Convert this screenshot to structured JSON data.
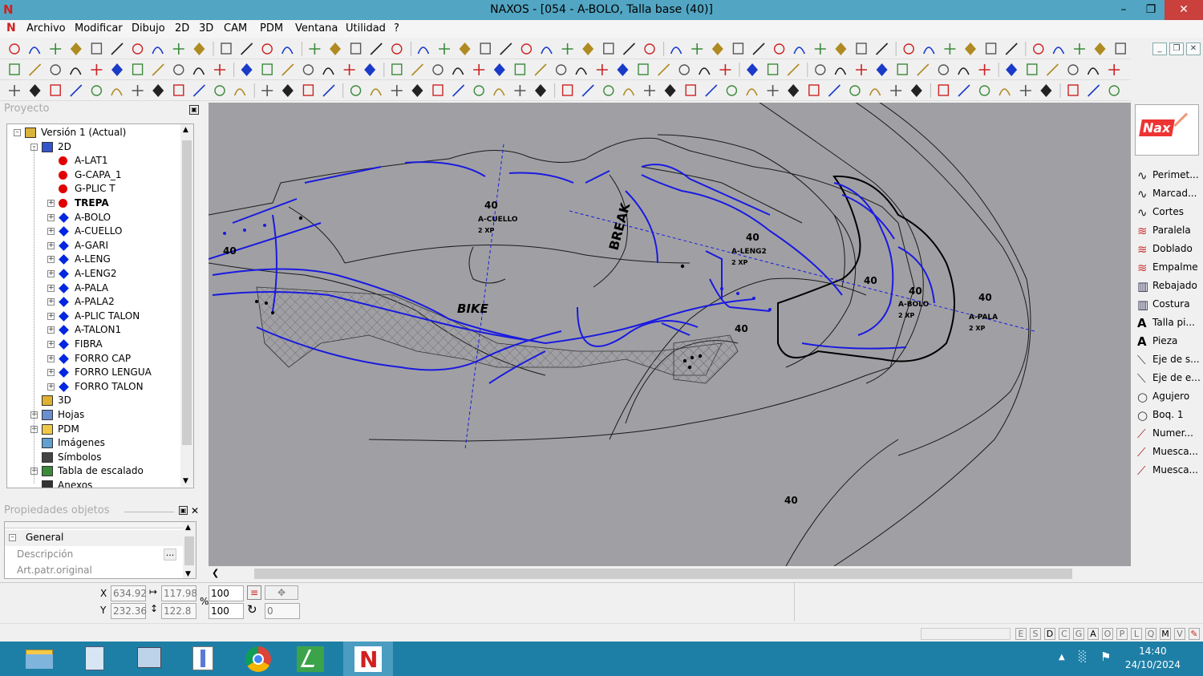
{
  "window": {
    "title": "NAXOS - [054 - A-BOLO, Talla base (40)]",
    "app_icon": "N"
  },
  "menu": [
    "Archivo",
    "Modificar",
    "Dibujo",
    "2D",
    "3D",
    "CAM",
    "PDM",
    "Ventana",
    "Utilidad",
    "?"
  ],
  "project_panel": {
    "title": "Proyecto"
  },
  "tree": [
    {
      "label": "Versión 1 (Actual)",
      "level": 0,
      "icon": "version-icon",
      "expander": "-"
    },
    {
      "label": "2D",
      "level": 1,
      "icon": "2d-icon",
      "expander": "-"
    },
    {
      "label": "A-LAT1",
      "level": 2,
      "icon": "red-dot"
    },
    {
      "label": "G-CAPA_1",
      "level": 2,
      "icon": "red-dot"
    },
    {
      "label": "G-PLIC T",
      "level": 2,
      "icon": "red-dot"
    },
    {
      "label": "TREPA",
      "level": 2,
      "icon": "red-dot",
      "expander": "+",
      "bold": true
    },
    {
      "label": "A-BOLO",
      "level": 2,
      "icon": "blue-diamond",
      "expander": "+"
    },
    {
      "label": "A-CUELLO",
      "level": 2,
      "icon": "blue-diamond",
      "expander": "+"
    },
    {
      "label": "A-GARI",
      "level": 2,
      "icon": "blue-diamond",
      "expander": "+"
    },
    {
      "label": "A-LENG",
      "level": 2,
      "icon": "blue-diamond",
      "expander": "+"
    },
    {
      "label": "A-LENG2",
      "level": 2,
      "icon": "blue-diamond",
      "expander": "+"
    },
    {
      "label": "A-PALA",
      "level": 2,
      "icon": "blue-diamond",
      "expander": "+"
    },
    {
      "label": "A-PALA2",
      "level": 2,
      "icon": "blue-diamond",
      "expander": "+"
    },
    {
      "label": "A-PLIC TALON",
      "level": 2,
      "icon": "blue-diamond",
      "expander": "+"
    },
    {
      "label": "A-TALON1",
      "level": 2,
      "icon": "blue-diamond",
      "expander": "+"
    },
    {
      "label": "FIBRA",
      "level": 2,
      "icon": "blue-diamond",
      "expander": "+"
    },
    {
      "label": "FORRO CAP",
      "level": 2,
      "icon": "blue-diamond",
      "expander": "+"
    },
    {
      "label": "FORRO LENGUA",
      "level": 2,
      "icon": "blue-diamond",
      "expander": "+"
    },
    {
      "label": "FORRO TALON",
      "level": 2,
      "icon": "blue-diamond",
      "expander": "+"
    },
    {
      "label": "3D",
      "level": 1,
      "icon": "3d-icon"
    },
    {
      "label": "Hojas",
      "level": 1,
      "icon": "sheets-icon",
      "expander": "+"
    },
    {
      "label": "PDM",
      "level": 1,
      "icon": "folder-icon",
      "expander": "+"
    },
    {
      "label": "Imágenes",
      "level": 1,
      "icon": "images-icon"
    },
    {
      "label": "Símbolos",
      "level": 1,
      "icon": "symbols-icon"
    },
    {
      "label": "Tabla de escalado",
      "level": 1,
      "icon": "table-icon",
      "expander": "+"
    },
    {
      "label": "Anexos",
      "level": 1,
      "icon": "attachment-icon"
    }
  ],
  "properties_panel": {
    "title": "Propiedades objetos",
    "group": "General",
    "rows": [
      {
        "label": "Descripción",
        "value": "",
        "button": "..."
      },
      {
        "label": "Art.patr.original",
        "value": ""
      }
    ]
  },
  "canvas": {
    "labels": [
      "40",
      "A-CUELLO",
      "2 XP",
      "40",
      "40",
      "A-LENG2",
      "2 XP",
      "40",
      "40",
      "A-BOLO",
      "2 XP",
      "40",
      "A-PALA",
      "2 XP",
      "40",
      "40",
      "40",
      "BREAK",
      "BIKE"
    ]
  },
  "right_tools": [
    {
      "label": "Perimet...",
      "icon": "curve-icon"
    },
    {
      "label": "Marcad...",
      "icon": "curve-icon"
    },
    {
      "label": "Cortes",
      "icon": "curve-icon"
    },
    {
      "label": "Paralela",
      "icon": "parallel-icon"
    },
    {
      "label": "Doblado",
      "icon": "parallel-icon"
    },
    {
      "label": "Empalme",
      "icon": "parallel-icon"
    },
    {
      "label": "Rebajado",
      "icon": "skive-icon"
    },
    {
      "label": "Costura",
      "icon": "skive-icon"
    },
    {
      "label": "Talla pi...",
      "icon": "text-a-icon"
    },
    {
      "label": "Pieza",
      "icon": "text-a-icon"
    },
    {
      "label": "Eje de s...",
      "icon": "axis-icon"
    },
    {
      "label": "Eje de e...",
      "icon": "axis-icon"
    },
    {
      "label": "Agujero",
      "icon": "circle-icon"
    },
    {
      "label": "Boq. 1",
      "icon": "circle-icon"
    },
    {
      "label": "Numer...",
      "icon": "pen-icon"
    },
    {
      "label": "Muesca...",
      "icon": "pen-icon"
    },
    {
      "label": "Muesca...",
      "icon": "pen-icon"
    }
  ],
  "brand": {
    "logo_text": "Nax"
  },
  "coords": {
    "x_label": "X",
    "y_label": "Y",
    "x": "634.92",
    "y": "232.36",
    "w": "117.98",
    "h": "122.8",
    "pct_sign": "%",
    "sx": "100",
    "sy": "100",
    "angle": "0"
  },
  "status_letters": [
    "E",
    "S",
    "D",
    "C",
    "G",
    "A",
    "O",
    "P",
    "L",
    "Q",
    "M",
    "V"
  ],
  "taskbar": {
    "time": "14:40",
    "date": "24/10/2024"
  },
  "colors": {
    "titlebar": "#52a6c3",
    "canvas": "#a0a0a4",
    "blue_lines": "#1a1ae0",
    "taskbar": "#1e7fa6",
    "close": "#c9403c"
  }
}
